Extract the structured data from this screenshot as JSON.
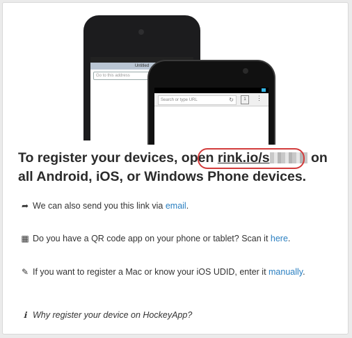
{
  "illustration": {
    "ios_title": "Untitled",
    "ios_address_placeholder": "Go to this address",
    "android_url_placeholder": "Search or type URL"
  },
  "headline": {
    "prefix": "To register your devices, open ",
    "link": "rink.io/s",
    "suffix": " on all Android, iOS, or Windows Phone devices."
  },
  "options": [
    {
      "icon": "share-icon",
      "text": "We can also send you this link via ",
      "link": "email",
      "after": "."
    },
    {
      "icon": "qrcode-icon",
      "text": "Do you have a QR code app on your phone or tablet? Scan it ",
      "link": "here",
      "after": "."
    },
    {
      "icon": "edit-icon",
      "text": "If you want to register a Mac or know your iOS UDID, enter it ",
      "link": "manually",
      "after": "."
    }
  ],
  "info": {
    "icon": "info-icon",
    "text": "Why register your device on HockeyApp?"
  },
  "colors": {
    "link": "#2a7fc1",
    "highlight": "#d23b3b"
  }
}
